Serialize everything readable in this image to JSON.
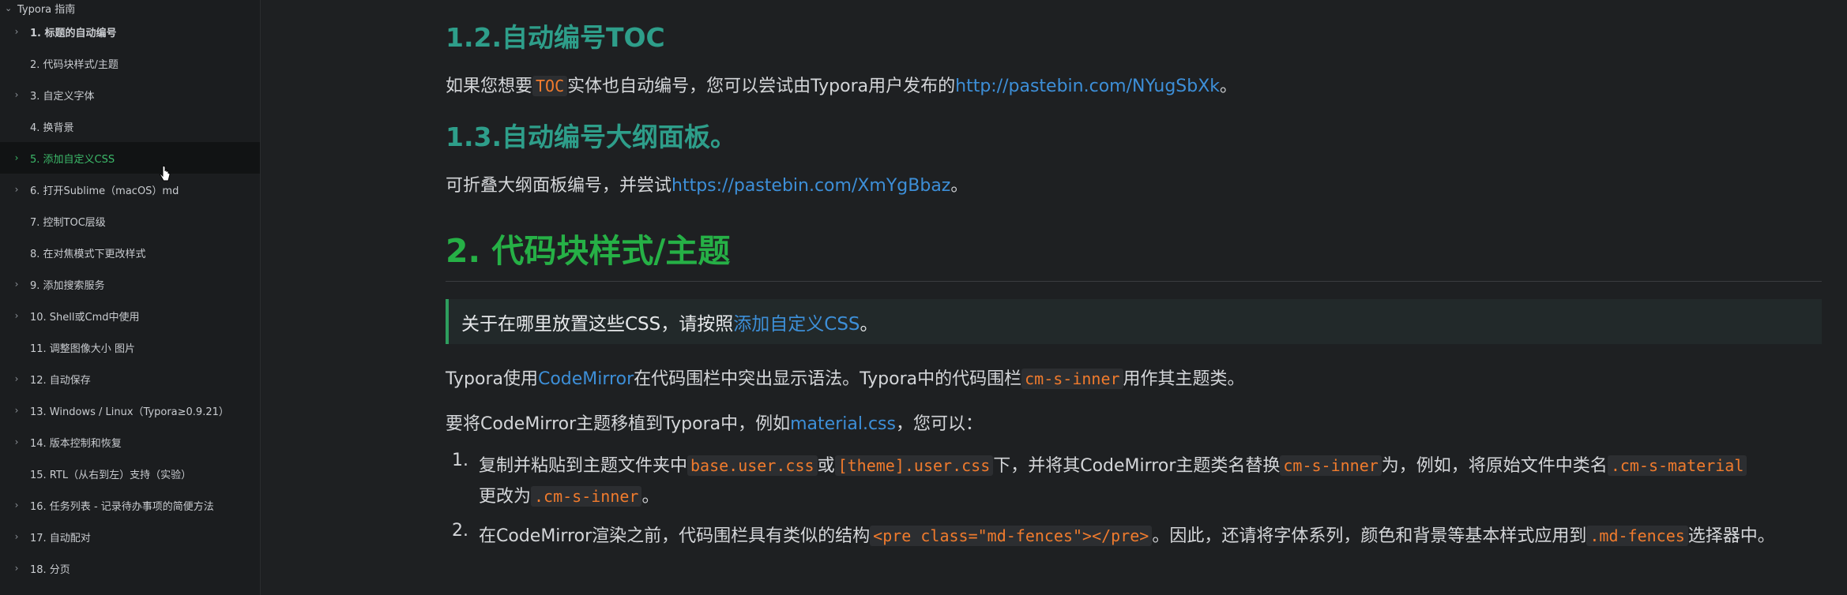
{
  "sidebar": {
    "root_label": "Typora 指南",
    "items": [
      {
        "label": "1. 标题的自动编号",
        "has_children": true
      },
      {
        "label": "2. 代码块样式/主题",
        "has_children": false
      },
      {
        "label": "3. 自定义字体",
        "has_children": true
      },
      {
        "label": "4. 换背景",
        "has_children": false
      },
      {
        "label": "5. 添加自定义CSS",
        "has_children": true
      },
      {
        "label": "6. 打开Sublime（macOS）md",
        "has_children": true
      },
      {
        "label": "7. 控制TOC层级",
        "has_children": false
      },
      {
        "label": "8. 在对焦模式下更改样式",
        "has_children": false
      },
      {
        "label": "9. 添加搜索服务",
        "has_children": true
      },
      {
        "label": "10. Shell或Cmd中使用",
        "has_children": true
      },
      {
        "label": "11. 调整图像大小 图片",
        "has_children": false
      },
      {
        "label": "12. 自动保存",
        "has_children": true
      },
      {
        "label": "13. Windows / Linux（Typora≥0.9.21）",
        "has_children": true
      },
      {
        "label": "14. 版本控制和恢复",
        "has_children": true
      },
      {
        "label": "15. RTL（从右到左）支持（实验）",
        "has_children": false
      },
      {
        "label": "16. 任务列表 - 记录待办事项的简便方法",
        "has_children": true
      },
      {
        "label": "17. 自动配对",
        "has_children": true
      },
      {
        "label": "18. 分页",
        "has_children": true
      }
    ],
    "active_index": 4
  },
  "content": {
    "h_1_2": "1.2.自动编号TOC",
    "p_1_2": {
      "pre": "如果您想要",
      "code": "TOC",
      "mid": "实体也自动编号，您可以尝试由Typora用户发布的",
      "link": "http://pastebin.com/NYugSbXk",
      "post": "。"
    },
    "h_1_3": "1.3.自动编号大纲面板。",
    "p_1_3": {
      "pre": "可折叠大纲面板编号，并尝试",
      "link": "https://pastebin.com/XmYgBbaz",
      "post": "。"
    },
    "h_2": "2. 代码块样式/主题",
    "quote": {
      "pre": "关于在哪里放置这些CSS，请按照",
      "link": "添加自定义CSS",
      "post": "。"
    },
    "p_cm": {
      "pre": "Typora使用",
      "link": "CodeMirror",
      "mid": "在代码围栏中突出显示语法。Typora中的代码围栏",
      "code": "cm-s-inner",
      "post": "用作其主题类。"
    },
    "p_port": {
      "pre": "要将CodeMirror主题移植到Typora中，例如",
      "link": "material.css",
      "post": "，您可以："
    },
    "list": [
      {
        "num": "1.",
        "t1": "复制并粘贴到主题文件夹中",
        "c1": "base.user.css",
        "t2": "或",
        "c2": "[theme].user.css",
        "t3": "下，并将其CodeMirror主题类名替换",
        "c3": "cm-s-inner",
        "t4": "为，例如，将原始文件中类名",
        "c4": ".cm-s-material",
        "t5": "更改为",
        "c5": ".cm-s-inner",
        "t6": "。"
      },
      {
        "num": "2.",
        "t1": "在CodeMirror渲染之前，代码围栏具有类似的结构",
        "c1": "<pre class=\"md-fences\"></pre>",
        "t2": "。因此，还请将字体系列，颜色和背景等基本样式应用到",
        "c2": ".md-fences",
        "t3": "选择器中。"
      }
    ]
  },
  "colors": {
    "heading_teal": "#2e9e8a",
    "heading_green": "#26b046",
    "link_blue": "#3d8fd8",
    "code_orange": "#f07b2d",
    "active_green": "#3cba6a"
  }
}
